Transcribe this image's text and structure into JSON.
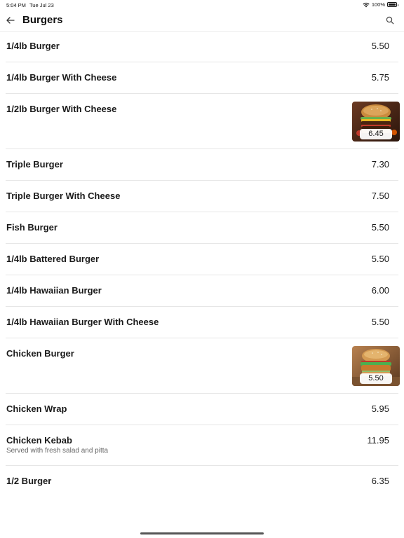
{
  "status_bar": {
    "time": "5:04 PM",
    "date": "Tue Jul 23",
    "battery": "100%"
  },
  "nav": {
    "title": "Burgers"
  },
  "items": [
    {
      "name": "1/4lb Burger",
      "price": "5.50"
    },
    {
      "name": "1/4lb Burger With Cheese",
      "price": "5.75"
    },
    {
      "name": "1/2lb Burger With Cheese",
      "price": "6.45",
      "image": "cheeseburger-photo"
    },
    {
      "name": "Triple Burger",
      "price": "7.30"
    },
    {
      "name": "Triple Burger With Cheese",
      "price": "7.50"
    },
    {
      "name": "Fish Burger",
      "price": "5.50"
    },
    {
      "name": "1/4lb Battered Burger",
      "price": "5.50"
    },
    {
      "name": "1/4lb Hawaiian Burger",
      "price": "6.00"
    },
    {
      "name": "1/4lb Hawaiian Burger With Cheese",
      "price": "5.50"
    },
    {
      "name": "Chicken Burger",
      "price": "5.50",
      "image": "chicken-burger-photo"
    },
    {
      "name": "Chicken Wrap",
      "price": "5.95"
    },
    {
      "name": "Chicken Kebab",
      "price": "11.95",
      "description": "Served with fresh salad and pitta"
    },
    {
      "name": "1/2 Burger",
      "price": "6.35"
    }
  ],
  "icons": {
    "back": "arrow-left-icon",
    "search": "search-icon",
    "wifi": "wifi-icon",
    "battery": "battery-icon"
  }
}
